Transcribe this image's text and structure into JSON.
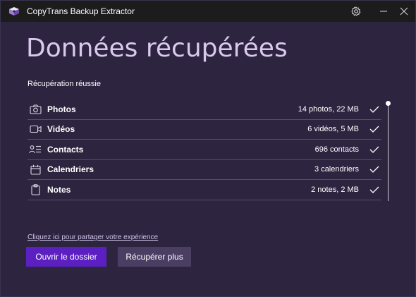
{
  "window": {
    "title": "CopyTrans Backup Extractor"
  },
  "titlebar_icons": {
    "settings": "gear-icon",
    "minimize": "minimize-icon",
    "close": "close-icon"
  },
  "main": {
    "heading": "Données récupérées",
    "status": "Récupération réussie",
    "items": [
      {
        "icon": "camera-icon",
        "label": "Photos",
        "info": "14 photos, 22 MB"
      },
      {
        "icon": "video-icon",
        "label": "Vidéos",
        "info": "6 vidéos, 5 MB"
      },
      {
        "icon": "contacts-icon",
        "label": "Contacts",
        "info": "696 contacts"
      },
      {
        "icon": "calendar-icon",
        "label": "Calendriers",
        "info": "3 calendriers"
      },
      {
        "icon": "notes-icon",
        "label": "Notes",
        "info": "2 notes, 2 MB"
      }
    ],
    "share_link": "Cliquez ici pour partager votre expérience",
    "open_folder_button": "Ouvrir le dossier",
    "recover_more_button": "Récupérer plus"
  },
  "colors": {
    "background": "#2d2540",
    "titlebar": "#1c1c1c",
    "heading": "#d9c9ec",
    "primary_button": "#5b1fc2",
    "secondary_button": "#4a3f63",
    "divider": "#54506a"
  }
}
